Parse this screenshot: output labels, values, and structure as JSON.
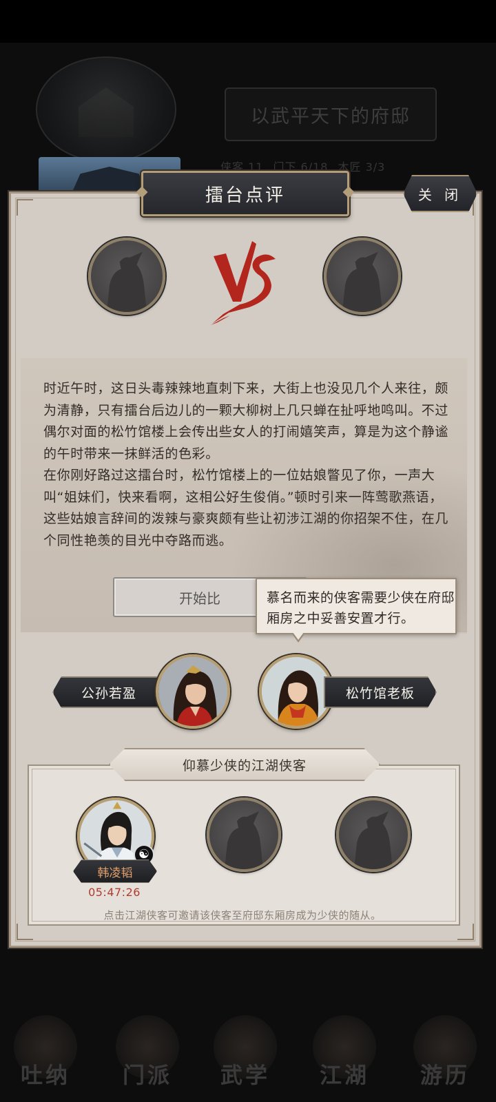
{
  "background": {
    "mansion_banner": "以武平天下的府邸",
    "stats": [
      "侠客 11",
      "门下 6/18",
      "木匠 3/3"
    ],
    "nav": [
      "吐纳",
      "门派",
      "武学",
      "江湖",
      "游历"
    ]
  },
  "modal": {
    "title": "擂台点评",
    "close_label": "关 闭",
    "vs_label": "VS",
    "story": "时近午时，这日头毒辣辣地直刺下来，大街上也没见几个人来往，颇为清静，只有擂台后边儿的一颗大柳树上几只蝉在扯呼地鸣叫。不过偶尔对面的松竹馆楼上会传出些女人的打闹嬉笑声，算是为这个静谧的午时带来一抹鲜活的色彩。\n在你刚好路过这擂台时，松竹馆楼上的一位姑娘瞥见了你，一声大叫“姐妹们，快来看啊，这相公好生俊俏。”顿时引来一阵莺歌燕语，这些姑娘言辞间的泼辣与豪爽颇有些让初涉江湖的你招架不住，在几个同性艳羡的目光中夺路而逃。",
    "start_button": "开始比",
    "tooltip": "慕名而来的侠客需要少侠在府邸厢房之中妥善安置才行。",
    "fighter_left": "公孙若盈",
    "fighter_right": "松竹馆老板",
    "followers_header": "仰慕少侠的江湖侠客",
    "follower": {
      "name": "韩凌韬",
      "timer": "05:47:26"
    },
    "hint": "点击江湖侠客可邀请该侠客至府邸东厢房成为少侠的随从。"
  },
  "colors": {
    "panel_bg": "#d3ccc5",
    "vs_red": "#b3261e",
    "timer_red": "#b23b2c",
    "follower_name": "#e2a06b"
  }
}
